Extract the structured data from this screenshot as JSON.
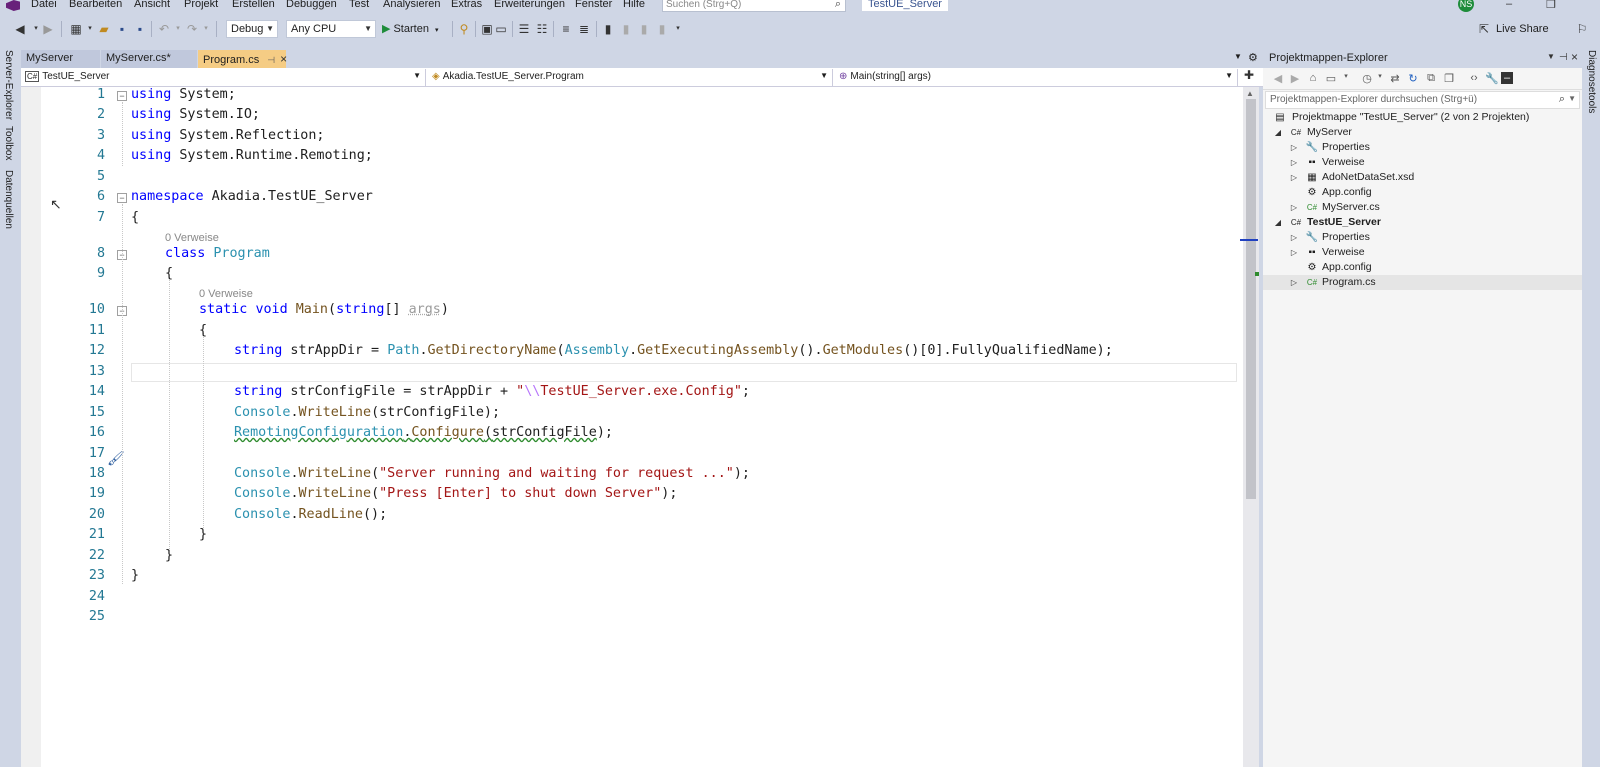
{
  "menu": [
    "Datei",
    "Bearbeiten",
    "Ansicht",
    "Projekt",
    "Erstellen",
    "Debuggen",
    "Test",
    "Analysieren",
    "Extras",
    "Erweiterungen",
    "Fenster",
    "Hilfe"
  ],
  "search": {
    "placeholder": "Suchen (Strg+Q)"
  },
  "solution_title": "TestUE_Server",
  "user_initials": "NS",
  "toolbar": {
    "config": "Debug",
    "platform": "Any CPU",
    "start_label": "Starten",
    "live_share": "Live Share"
  },
  "side_tabs_left": [
    "Server-Explorer",
    "Toolbox",
    "Datenquellen"
  ],
  "side_tabs_right": [
    "Diagnosetools"
  ],
  "doc_tabs": [
    {
      "label": "MyServer",
      "active": false
    },
    {
      "label": "MyServer.cs*",
      "active": false
    },
    {
      "label": "Program.cs",
      "active": true
    }
  ],
  "nav": {
    "project": "TestUE_Server",
    "type": "Akadia.TestUE_Server.Program",
    "member": "Main(string[] args)"
  },
  "code_lens": {
    "program_refs": "0 Verweise",
    "main_refs": "0 Verweise"
  },
  "line_numbers": [
    "1",
    "2",
    "3",
    "4",
    "5",
    "6",
    "7",
    "8",
    "9",
    "10",
    "11",
    "12",
    "13",
    "14",
    "15",
    "16",
    "17",
    "18",
    "19",
    "20",
    "21",
    "22",
    "23",
    "24",
    "25"
  ],
  "code": {
    "l1_kw": "using",
    "l1_rest": " System;",
    "l2_kw": "using",
    "l2_rest": " System.IO;",
    "l3_kw": "using",
    "l3_rest": " System.Reflection;",
    "l4_kw": "using",
    "l4_rest": " System.Runtime.Remoting;",
    "l6_kw": "namespace",
    "l6_rest": " Akadia.TestUE_Server",
    "brace_open": "{",
    "brace_close": "}",
    "l8_kw": "class",
    "l8_name": "Program",
    "l10_kw1": "static",
    "l10_kw2": "void",
    "l10_method": "Main",
    "l10_p1": "(",
    "l10_type": "string",
    "l10_p2": "[] ",
    "l10_param": "args",
    "l10_p3": ")",
    "l12_type": "string",
    "l12_a": " strAppDir = ",
    "l12_cls1": "Path",
    "l12_dot1": ".",
    "l12_m1": "GetDirectoryName",
    "l12_p1": "(",
    "l12_cls2": "Assembly",
    "l12_dot2": ".",
    "l12_m2": "GetExecutingAssembly",
    "l12_p2": "().",
    "l12_m3": "GetModules",
    "l12_p3": "()[0].FullyQualifiedName);",
    "l14_type": "string",
    "l14_a": " strConfigFile = strAppDir + ",
    "l14_q": "\"",
    "l14_esc": "\\\\",
    "l14_str": "TestUE_Server.exe.Config\"",
    "l14_end": ";",
    "l15_cls": "Console",
    "l15_dot": ".",
    "l15_m": "WriteLine",
    "l15_rest": "(strConfigFile);",
    "l16_cls": "RemotingConfiguration",
    "l16_dot": ".",
    "l16_m": "Configure",
    "l16_p": "(",
    "l16_arg": "strConfigFile",
    "l16_end": ");",
    "l18_cls": "Console",
    "l18_dot": ".",
    "l18_m": "WriteLine",
    "l18_p": "(",
    "l18_str": "\"Server running and waiting for request ...\"",
    "l18_end": ");",
    "l19_cls": "Console",
    "l19_dot": ".",
    "l19_m": "WriteLine",
    "l19_p": "(",
    "l19_str": "\"Press [Enter] to shut down Server\"",
    "l19_end": ");",
    "l20_cls": "Console",
    "l20_dot": ".",
    "l20_m": "ReadLine",
    "l20_end": "();"
  },
  "explorer": {
    "title": "Projektmappen-Explorer",
    "search_placeholder": "Projektmappen-Explorer durchsuchen (Strg+ü)",
    "solution": "Projektmappe \"TestUE_Server\" (2 von 2 Projekten)",
    "nodes": [
      {
        "label": "MyServer"
      },
      {
        "label": "Properties"
      },
      {
        "label": "Verweise"
      },
      {
        "label": "AdoNetDataSet.xsd"
      },
      {
        "label": "App.config"
      },
      {
        "label": "MyServer.cs"
      },
      {
        "label": "TestUE_Server"
      },
      {
        "label": "Properties"
      },
      {
        "label": "Verweise"
      },
      {
        "label": "App.config"
      },
      {
        "label": "Program.cs"
      }
    ]
  }
}
